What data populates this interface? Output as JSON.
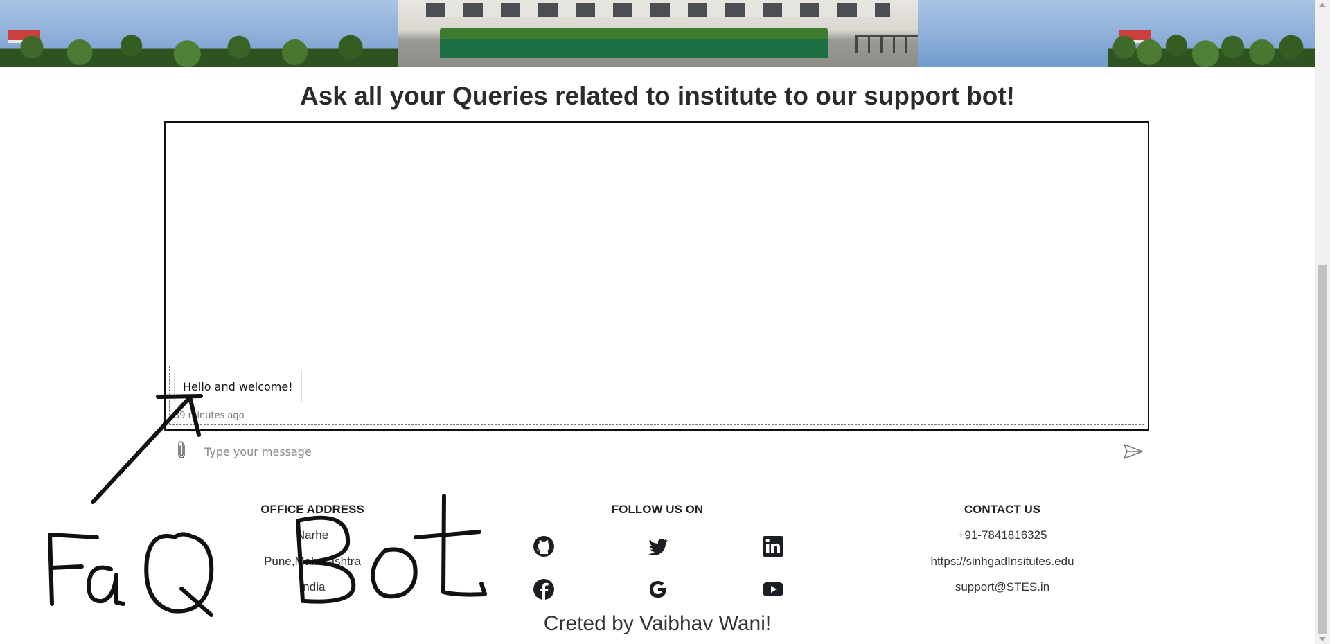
{
  "heading": "Ask all your Queries related to institute to our support bot!",
  "chat": {
    "messages": [
      {
        "text": "Hello and welcome!",
        "time": "39 minutes ago"
      }
    ],
    "input_placeholder": "Type your message"
  },
  "footer": {
    "address": {
      "title": "OFFICE ADDRESS",
      "lines": [
        "Narhe",
        "Pune,Maharashtra",
        "India"
      ]
    },
    "follow": {
      "title": "FOLLOW US ON",
      "icons": [
        "github-icon",
        "twitter-icon",
        "linkedin-icon",
        "facebook-icon",
        "google-icon",
        "youtube-icon"
      ]
    },
    "contact": {
      "title": "CONTACT US",
      "phone": "+91-7841816325",
      "website": "https://sinhgadInsitutes.edu",
      "email": "support@STES.in"
    }
  },
  "credit": "Creted by Vaibhav Wani!",
  "annotation": {
    "text": "FaQ Bot",
    "color": "#111111"
  },
  "colors": {
    "heading": "#2b2b2b",
    "chat_border": "#111111",
    "scrollbar_track": "#f1f1f1",
    "scrollbar_thumb": "#c1c1c1"
  }
}
